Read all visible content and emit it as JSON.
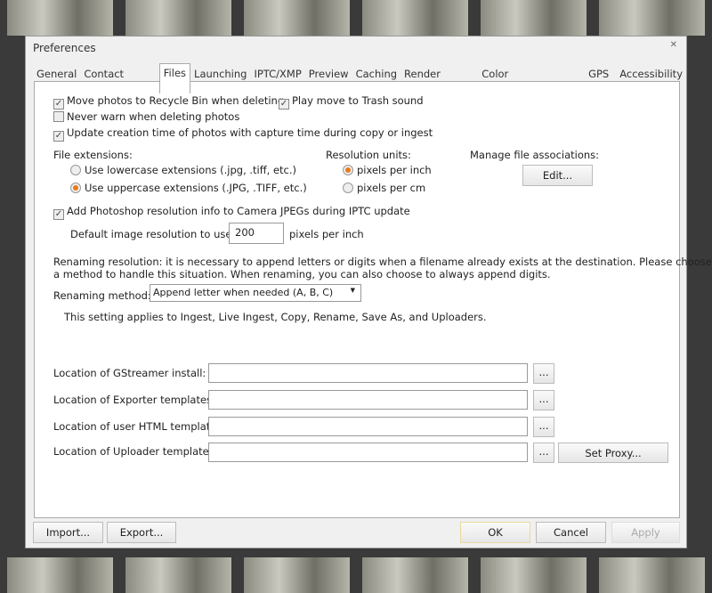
{
  "title": "Preferences",
  "tabs": [
    "General",
    "Contact Sheet",
    "Files",
    "Launching",
    "IPTC/XMP",
    "Preview",
    "Caching",
    "Render Cache",
    "Color Management",
    "GPS",
    "Accessibility"
  ],
  "active_tab": "Files",
  "options": {
    "recycle": {
      "label": "Move photos to Recycle Bin when deleting",
      "checked": true
    },
    "trash_sound": {
      "label": "Play move to Trash sound",
      "checked": true
    },
    "never_warn": {
      "label": "Never warn when deleting photos",
      "checked": false
    },
    "update_time": {
      "label": "Update creation time of photos with capture time during copy or ingest",
      "checked": true
    }
  },
  "file_ext": {
    "label": "File extensions:",
    "lower": "Use lowercase extensions (.jpg, .tiff, etc.)",
    "upper": "Use uppercase extensions (.JPG, .TIFF, etc.)",
    "selected": "upper"
  },
  "res_units": {
    "label": "Resolution units:",
    "inch": "pixels per inch",
    "cm": "pixels per cm",
    "selected": "inch"
  },
  "assoc": {
    "label": "Manage file associations:",
    "button": "Edit..."
  },
  "photoshop": {
    "label": "Add Photoshop resolution info to Camera JPEGs during IPTC update",
    "checked": true
  },
  "default_res": {
    "label": "Default image resolution to use:",
    "value": "200",
    "unit": "pixels per inch"
  },
  "renaming": {
    "text1": "Renaming resolution: it is necessary to append letters or digits when a filename already exists at the destination.  Please choose",
    "text2": "a method to handle this situation.  When renaming, you can also choose to always append digits.",
    "method_label": "Renaming method:",
    "method_value": "Append letter when needed (A, B, C)",
    "note": "This setting applies to Ingest, Live Ingest, Copy, Rename, Save As, and Uploaders."
  },
  "locations": [
    {
      "label": "Location of GStreamer install:",
      "value": ""
    },
    {
      "label": "Location of Exporter templates:",
      "value": ""
    },
    {
      "label": "Location of user HTML templates:",
      "value": ""
    },
    {
      "label": "Location of Uploader templates:",
      "value": ""
    }
  ],
  "browse": "...",
  "set_proxy": "Set Proxy...",
  "buttons": {
    "import": "Import...",
    "export": "Export...",
    "ok": "OK",
    "cancel": "Cancel",
    "apply": "Apply"
  },
  "accent": "#e87a1a"
}
